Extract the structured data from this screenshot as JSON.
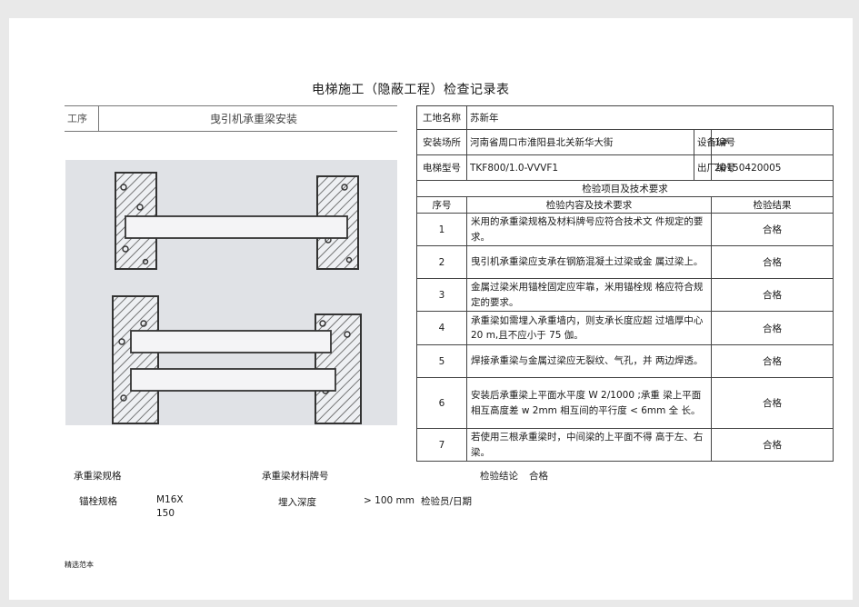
{
  "title": "电梯施工（隐蔽工程）检查记录表",
  "process": {
    "label": "工序",
    "value": "曳引机承重梁安装"
  },
  "info": {
    "site_label": "工地名称",
    "site_value": "苏新年",
    "location_label": "安装场所",
    "location_value": "河南省周口市淮阳县北关新华大街",
    "device_no_label": "设备编号",
    "device_no_value": "1#",
    "model_label": "电梯型号",
    "model_value": "TKF800/1.0-VVVF1",
    "factory_no_label": "出厂编号",
    "factory_no_value": "20150420005"
  },
  "section_title": "检验项目及技术要求",
  "columns": {
    "no": "序号",
    "content": "检验内容及技术要求",
    "result": "检验结果"
  },
  "items": [
    {
      "no": "1",
      "text": "米用的承重梁规格及材料牌号应符合技术文 件规定的要求。",
      "result": "合格"
    },
    {
      "no": "2",
      "text": "曳引机承重梁应支承在钢筋混凝土过梁或金 属过梁上。",
      "result": "合格"
    },
    {
      "no": "3",
      "text": "金属过梁米用锚栓固定应牢靠，米用锚栓规 格应符合规定的要求。",
      "result": "合格"
    },
    {
      "no": "4",
      "text": "承重梁如需埋入承重墙内，则支承长度应超 过墙厚中心 20 m,且不应小于 75 伽。",
      "result": "合格"
    },
    {
      "no": "5",
      "text": "焊接承重梁与金属过梁应无裂纹、气孔，并 两边焊透。",
      "result": "合格"
    },
    {
      "no": "6",
      "text": "安装后承重梁上平面水平度 W 2/1000 ;承重 梁上平面相互高度差 w 2mm 相互间的平行度 < 6mm 全 长。",
      "result": "合格"
    },
    {
      "no": "7",
      "text": "若使用三根承重梁时，中间梁的上平面不得 高于左、右梁。",
      "result": "合格"
    }
  ],
  "footer": {
    "beam_spec_label": "承重梁规格",
    "beam_material_label": "承重梁材料牌号",
    "conclusion_label": "检验结论",
    "conclusion_value": "合格",
    "anchor_spec_label": "锚栓规格",
    "anchor_spec_value": "M16X",
    "anchor_spec_value2": "150",
    "embed_depth_label": "埋入深度",
    "embed_depth_value": "> 100 mm",
    "inspector_label": "检验员/日期",
    "sample_text": "精选范本"
  },
  "colors": {
    "page": "#ffffff",
    "background": "#e9e9e9",
    "line": "#444444",
    "drawing_bg": "#d9dbe0"
  }
}
